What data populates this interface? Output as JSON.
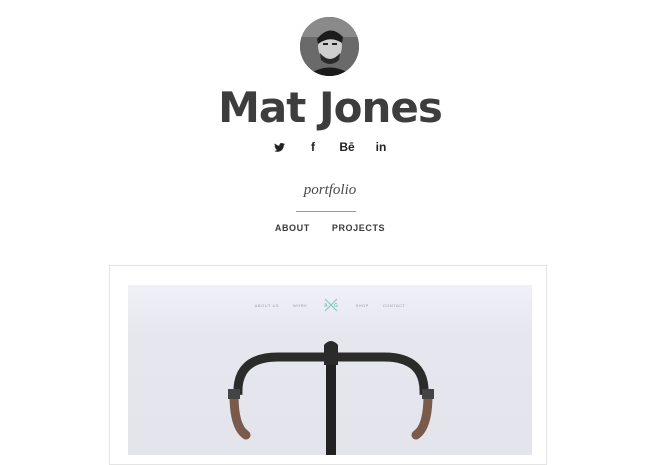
{
  "profile": {
    "name": "Mat Jones",
    "tagline": "portfolio"
  },
  "social": [
    {
      "icon": "twitter-icon",
      "glyph": ""
    },
    {
      "icon": "facebook-icon",
      "glyph": "f"
    },
    {
      "icon": "behance-icon",
      "glyph": "Bē"
    },
    {
      "icon": "linkedin-icon",
      "glyph": "in"
    }
  ],
  "nav": {
    "about": "ABOUT",
    "projects": "PROJECTS"
  },
  "project_preview": {
    "nav": {
      "about": "ABOUT US",
      "work": "WORK",
      "shop": "SHOP",
      "contact": "CONTACT"
    },
    "logo_letters": [
      "A",
      "G"
    ]
  },
  "colors": {
    "accent": "#7fc9b3",
    "text": "#3d3d3d",
    "preview_bg": "#eeeef6"
  }
}
